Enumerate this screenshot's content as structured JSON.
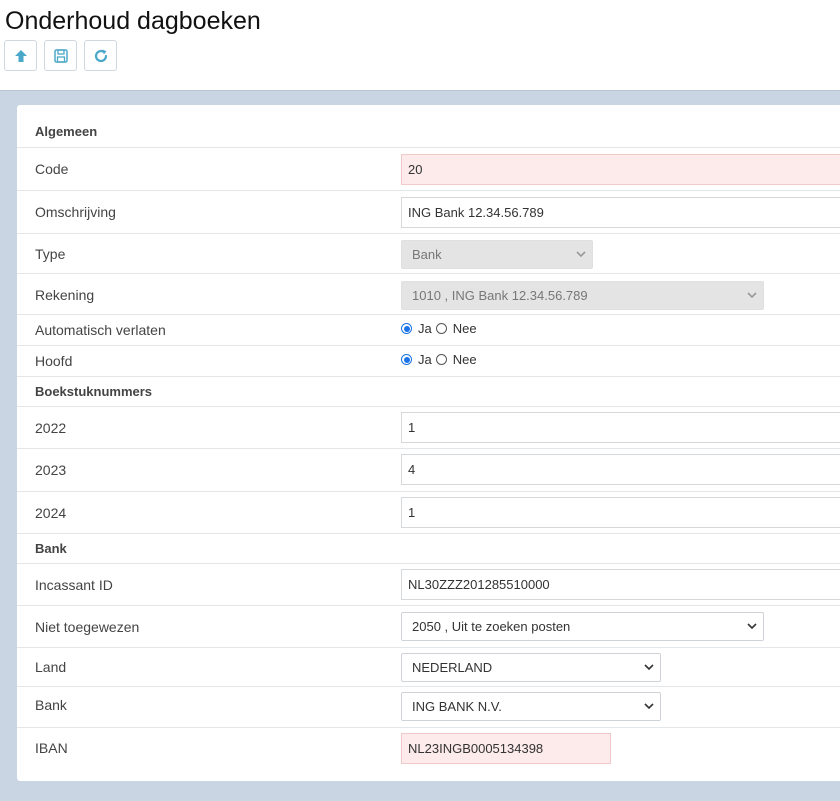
{
  "page": {
    "title": "Onderhoud dagboeken"
  },
  "toolbar": {
    "buttons": [
      {
        "icon": "arrow-up-icon"
      },
      {
        "icon": "save-icon"
      },
      {
        "icon": "refresh-icon"
      }
    ]
  },
  "colors": {
    "accent": "#4aa8c9",
    "error_field_bg": "#fdeaea",
    "page_bg": "#c9d5e2"
  },
  "form": {
    "algemeen": {
      "header": "Algemeen",
      "code_label": "Code",
      "code_value": "20",
      "omschrijving_label": "Omschrijving",
      "omschrijving_value": "ING Bank 12.34.56.789",
      "type_label": "Type",
      "type_value": "Bank",
      "rekening_label": "Rekening",
      "rekening_value": "1010 , ING Bank 12.34.56.789",
      "auto_label": "Automatisch verlaten",
      "auto_yes": "Ja",
      "auto_no": "Nee",
      "auto_selected": "Ja",
      "hoofd_label": "Hoofd",
      "hoofd_yes": "Ja",
      "hoofd_no": "Nee",
      "hoofd_selected": "Ja"
    },
    "boekstuk": {
      "header": "Boekstuknummers",
      "y2022_label": "2022",
      "y2022_value": "1",
      "y2023_label": "2023",
      "y2023_value": "4",
      "y2024_label": "2024",
      "y2024_value": "1"
    },
    "bank": {
      "header": "Bank",
      "incassant_label": "Incassant ID",
      "incassant_value": "NL30ZZZ201285510000",
      "niet_label": "Niet toegewezen",
      "niet_value": "2050 , Uit te zoeken posten",
      "land_label": "Land",
      "land_value": "NEDERLAND",
      "bank_label": "Bank",
      "bank_value": "ING BANK N.V.",
      "iban_label": "IBAN",
      "iban_value": "NL23INGB0005134398"
    }
  }
}
